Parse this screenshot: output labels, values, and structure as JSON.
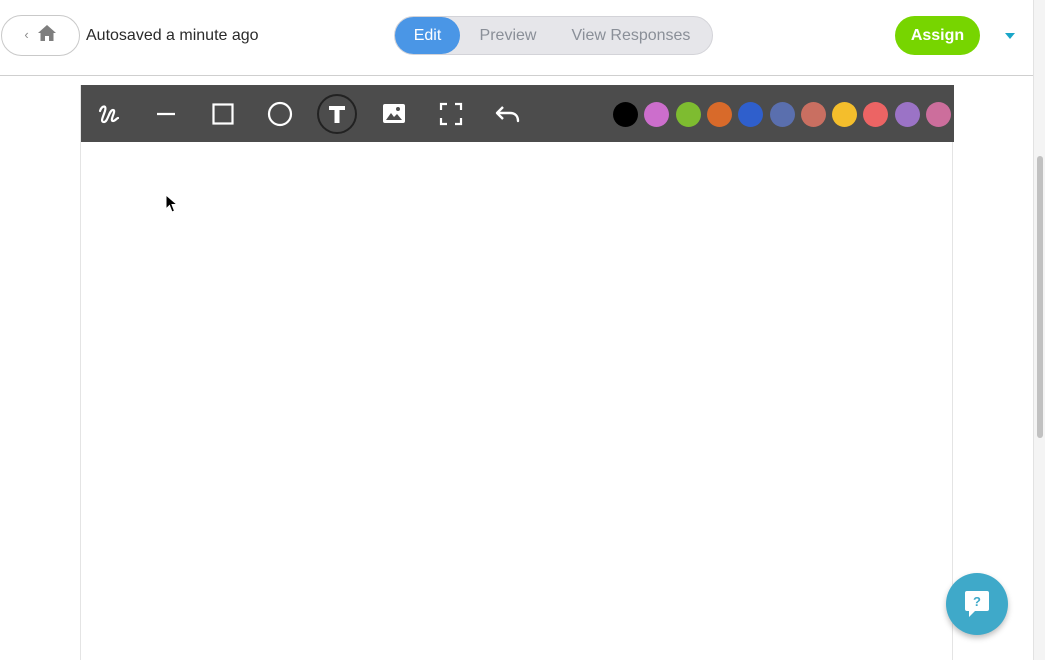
{
  "header": {
    "autosave_text": "Autosaved a minute ago",
    "tabs": [
      {
        "label": "Edit",
        "active": true
      },
      {
        "label": "Preview",
        "active": false
      },
      {
        "label": "View Responses",
        "active": false
      }
    ],
    "assign_label": "Assign"
  },
  "toolbar": {
    "tools": [
      "freehand-icon",
      "line-icon",
      "rectangle-icon",
      "circle-icon",
      "text-icon",
      "image-icon",
      "crop-icon",
      "undo-icon"
    ],
    "selected_tool": "text-icon",
    "colors": [
      "#000000",
      "#cc6ecc",
      "#7ebc30",
      "#d86a2a",
      "#2f5fcc",
      "#5a6fae",
      "#c96f61",
      "#f4be2c",
      "#ec6464",
      "#9b73c6",
      "#cc6e9c"
    ]
  },
  "help": {
    "icon": "help-question-icon"
  },
  "colors": {
    "accent": "#4a96e6",
    "assign": "#77d500",
    "toolbar": "#4c4c4c",
    "help": "#3fa9c9"
  }
}
